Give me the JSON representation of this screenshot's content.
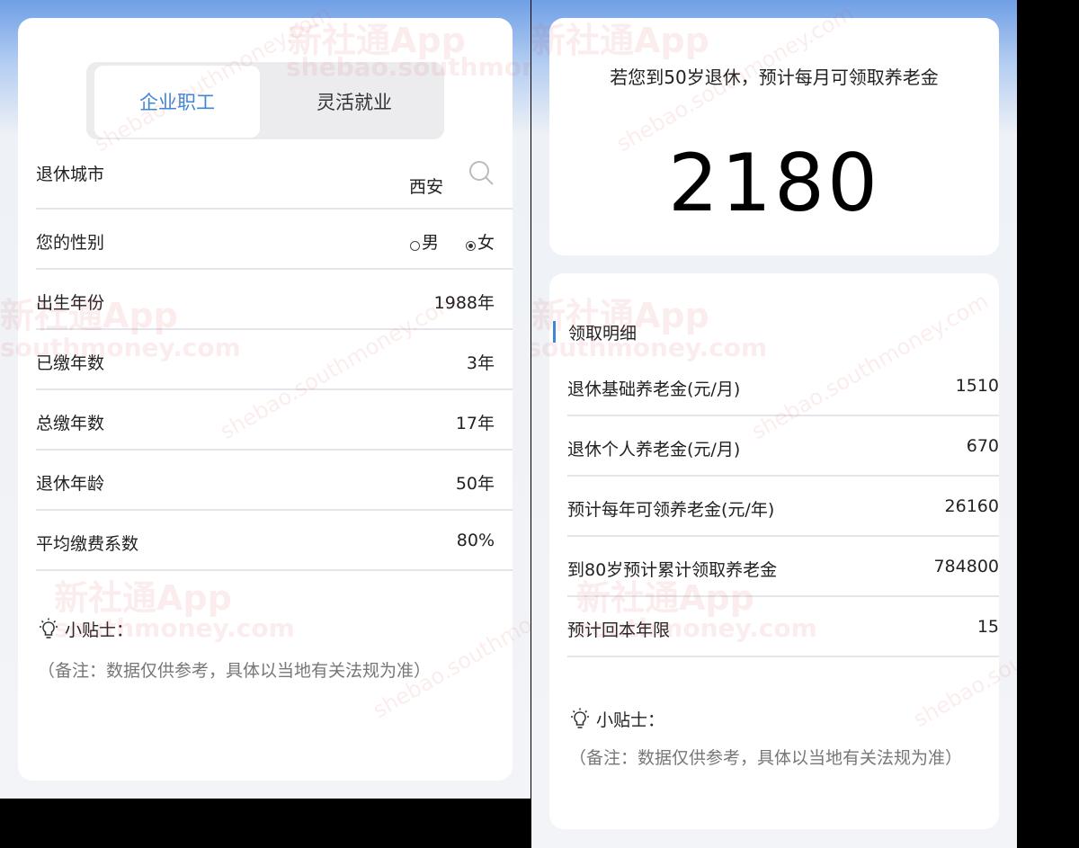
{
  "left": {
    "tabs": [
      {
        "label": "企业职工",
        "active": true
      },
      {
        "label": "灵活就业",
        "active": false
      }
    ],
    "rows": {
      "city": {
        "label": "退休城市",
        "value": "西安"
      },
      "gender": {
        "label": "您的性别",
        "options": [
          "男",
          "女"
        ],
        "selected": "女"
      },
      "birth_year": {
        "label": "出生年份",
        "value": "1988年"
      },
      "paid_years": {
        "label": "已缴年数",
        "value": "3年"
      },
      "total_years": {
        "label": "总缴年数",
        "value": "17年"
      },
      "retire_age": {
        "label": "退休年龄",
        "value": "50年"
      },
      "contribution_ratio": {
        "label": "平均缴费系数",
        "value": "80%"
      }
    },
    "tip": {
      "title": "小贴士：",
      "note": "（备注：数据仅供参考，具体以当地有关法规为准）"
    }
  },
  "right": {
    "result": {
      "headline": "若您到50岁退休，预计每月可领取养老金",
      "amount": "2180"
    },
    "detail": {
      "heading": "领取明细",
      "rows": [
        {
          "label": "退休基础养老金(元/月)",
          "value": "1510"
        },
        {
          "label": "退休个人养老金(元/月)",
          "value": "670"
        },
        {
          "label": "预计每年可领养老金(元/年)",
          "value": "26160"
        },
        {
          "label": "到80岁预计累计领取养老金",
          "value": "784800"
        },
        {
          "label": "预计回本年限",
          "value": "15"
        }
      ]
    },
    "tip": {
      "title": "小贴士：",
      "note": "（备注：数据仅供参考，具体以当地有关法规为准）"
    }
  },
  "watermark": {
    "brand": "新社通App",
    "url": "shebao.southmoney.com",
    "url_short": "southmoney.com"
  },
  "colors": {
    "accent": "#3f86d4",
    "watermark_red": "#c8161e",
    "header_blue": "#6f9fe6"
  },
  "icons": [
    "search-icon",
    "lightbulb-icon",
    "radio-icon"
  ]
}
